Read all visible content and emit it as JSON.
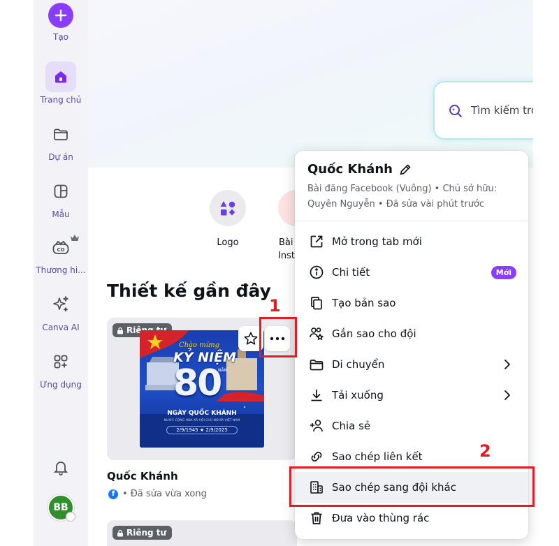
{
  "sidebar": {
    "create_label": "Tạo",
    "items": [
      {
        "label": "Trang chủ"
      },
      {
        "label": "Dự án"
      },
      {
        "label": "Mẫu"
      },
      {
        "label": "Thương hi..."
      },
      {
        "label": "Canva AI"
      },
      {
        "label": "Ứng dụng"
      }
    ],
    "avatar_initials": "BB"
  },
  "search": {
    "placeholder": "Tìm kiếm tro"
  },
  "quick_actions": [
    {
      "label": "Logo"
    },
    {
      "label": "Bài",
      "label2": "Insta"
    }
  ],
  "recent": {
    "title": "Thiết kế gần đây",
    "card": {
      "badge": "Riêng tư",
      "title": "Quốc Khánh",
      "meta": "• Đã sửa vừa xong",
      "thumb": {
        "line1": "Chào mừng",
        "line2": "KỶ NIỆM",
        "line3": "80",
        "line3b": "NĂM",
        "line4": "NGÀY QUỐC KHÁNH",
        "line5": "NƯỚC CỘNG HÒA XÃ HỘI CHỦ NGHĨA VIỆT NAM",
        "line6": "2/9/1945 ★ 2/9/2025",
        "corner": "YD"
      }
    },
    "card2": {
      "badge": "Riêng tư"
    }
  },
  "context_menu": {
    "title": "Quốc Khánh",
    "subtitle": "Bài đăng Facebook (Vuông) • Chủ sở hữu: Quyên Nguyễn • Đã sửa vài phút trước",
    "items": [
      {
        "label": "Mở trong tab mới",
        "icon": "external-link-icon"
      },
      {
        "label": "Chi tiết",
        "icon": "info-icon",
        "badge": "Mới"
      },
      {
        "label": "Tạo bản sao",
        "icon": "copy-icon"
      },
      {
        "label": "Gắn sao cho đội",
        "icon": "team-star-icon"
      },
      {
        "label": "Di chuyển",
        "icon": "folder-icon",
        "submenu": true
      },
      {
        "label": "Tải xuống",
        "icon": "download-icon",
        "submenu": true
      },
      {
        "label": "Chia sẻ",
        "icon": "share-people-icon"
      },
      {
        "label": "Sao chép liên kết",
        "icon": "link-icon"
      },
      {
        "label": "Sao chép sang đội khác",
        "icon": "building-icon"
      },
      {
        "label": "Đưa vào thùng rác",
        "icon": "trash-icon"
      }
    ]
  },
  "annotations": {
    "step1": "1",
    "step2": "2"
  },
  "colors": {
    "accent": "#8b3dff",
    "annotation_red": "#e31b23",
    "sidebar_bg": "#f3f2f7"
  }
}
